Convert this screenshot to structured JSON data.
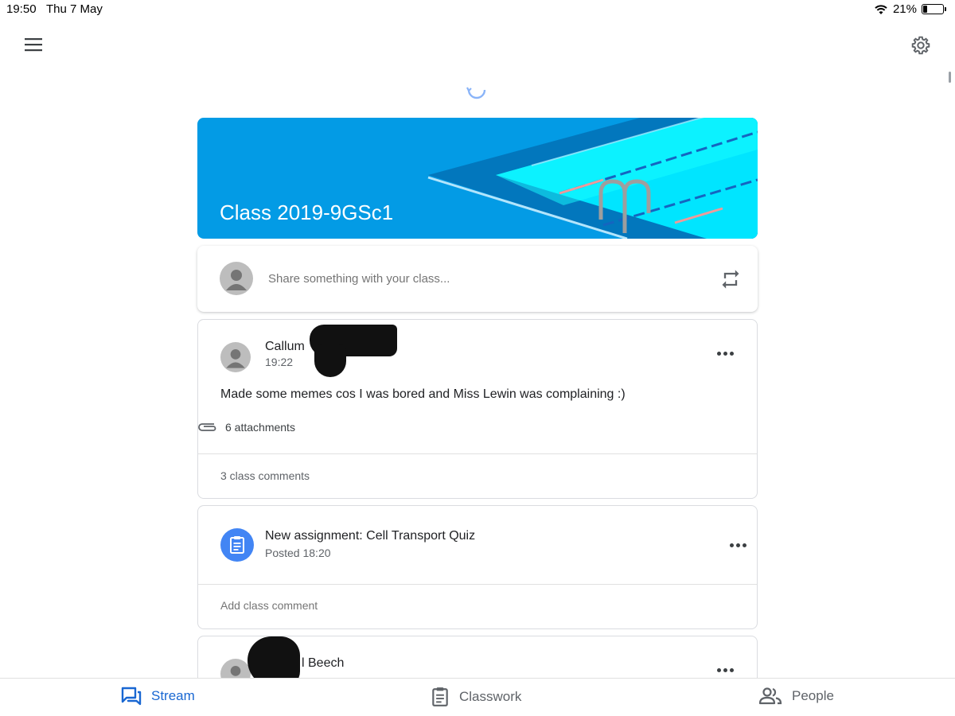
{
  "status_bar": {
    "time": "19:50",
    "date": "Thu 7 May",
    "battery": "21%",
    "battery_level": 0.21
  },
  "header": {
    "menu_icon": "menu-icon",
    "settings_icon": "gear-icon"
  },
  "class_banner": {
    "title": "Class 2019-9GSc1",
    "color": "#039be5"
  },
  "share": {
    "placeholder": "Share something with your class..."
  },
  "posts": [
    {
      "author": "Callum",
      "time": "19:22",
      "body": "Made some memes cos I was bored and Miss Lewin was complaining :)",
      "attachments": "6 attachments",
      "comments": "3 class comments"
    }
  ],
  "assignment": {
    "title": "New assignment: Cell Transport Quiz",
    "posted": "Posted 18:20",
    "add_comment": "Add class comment"
  },
  "post2": {
    "author": "l Beech"
  },
  "bottom_nav": [
    {
      "label": "Stream",
      "icon": "stream-icon",
      "active": true
    },
    {
      "label": "Classwork",
      "icon": "classwork-icon",
      "active": false
    },
    {
      "label": "People",
      "icon": "people-icon",
      "active": false
    }
  ],
  "colors": {
    "accent": "#1967d2",
    "assignment_icon_bg": "#4285f4"
  }
}
